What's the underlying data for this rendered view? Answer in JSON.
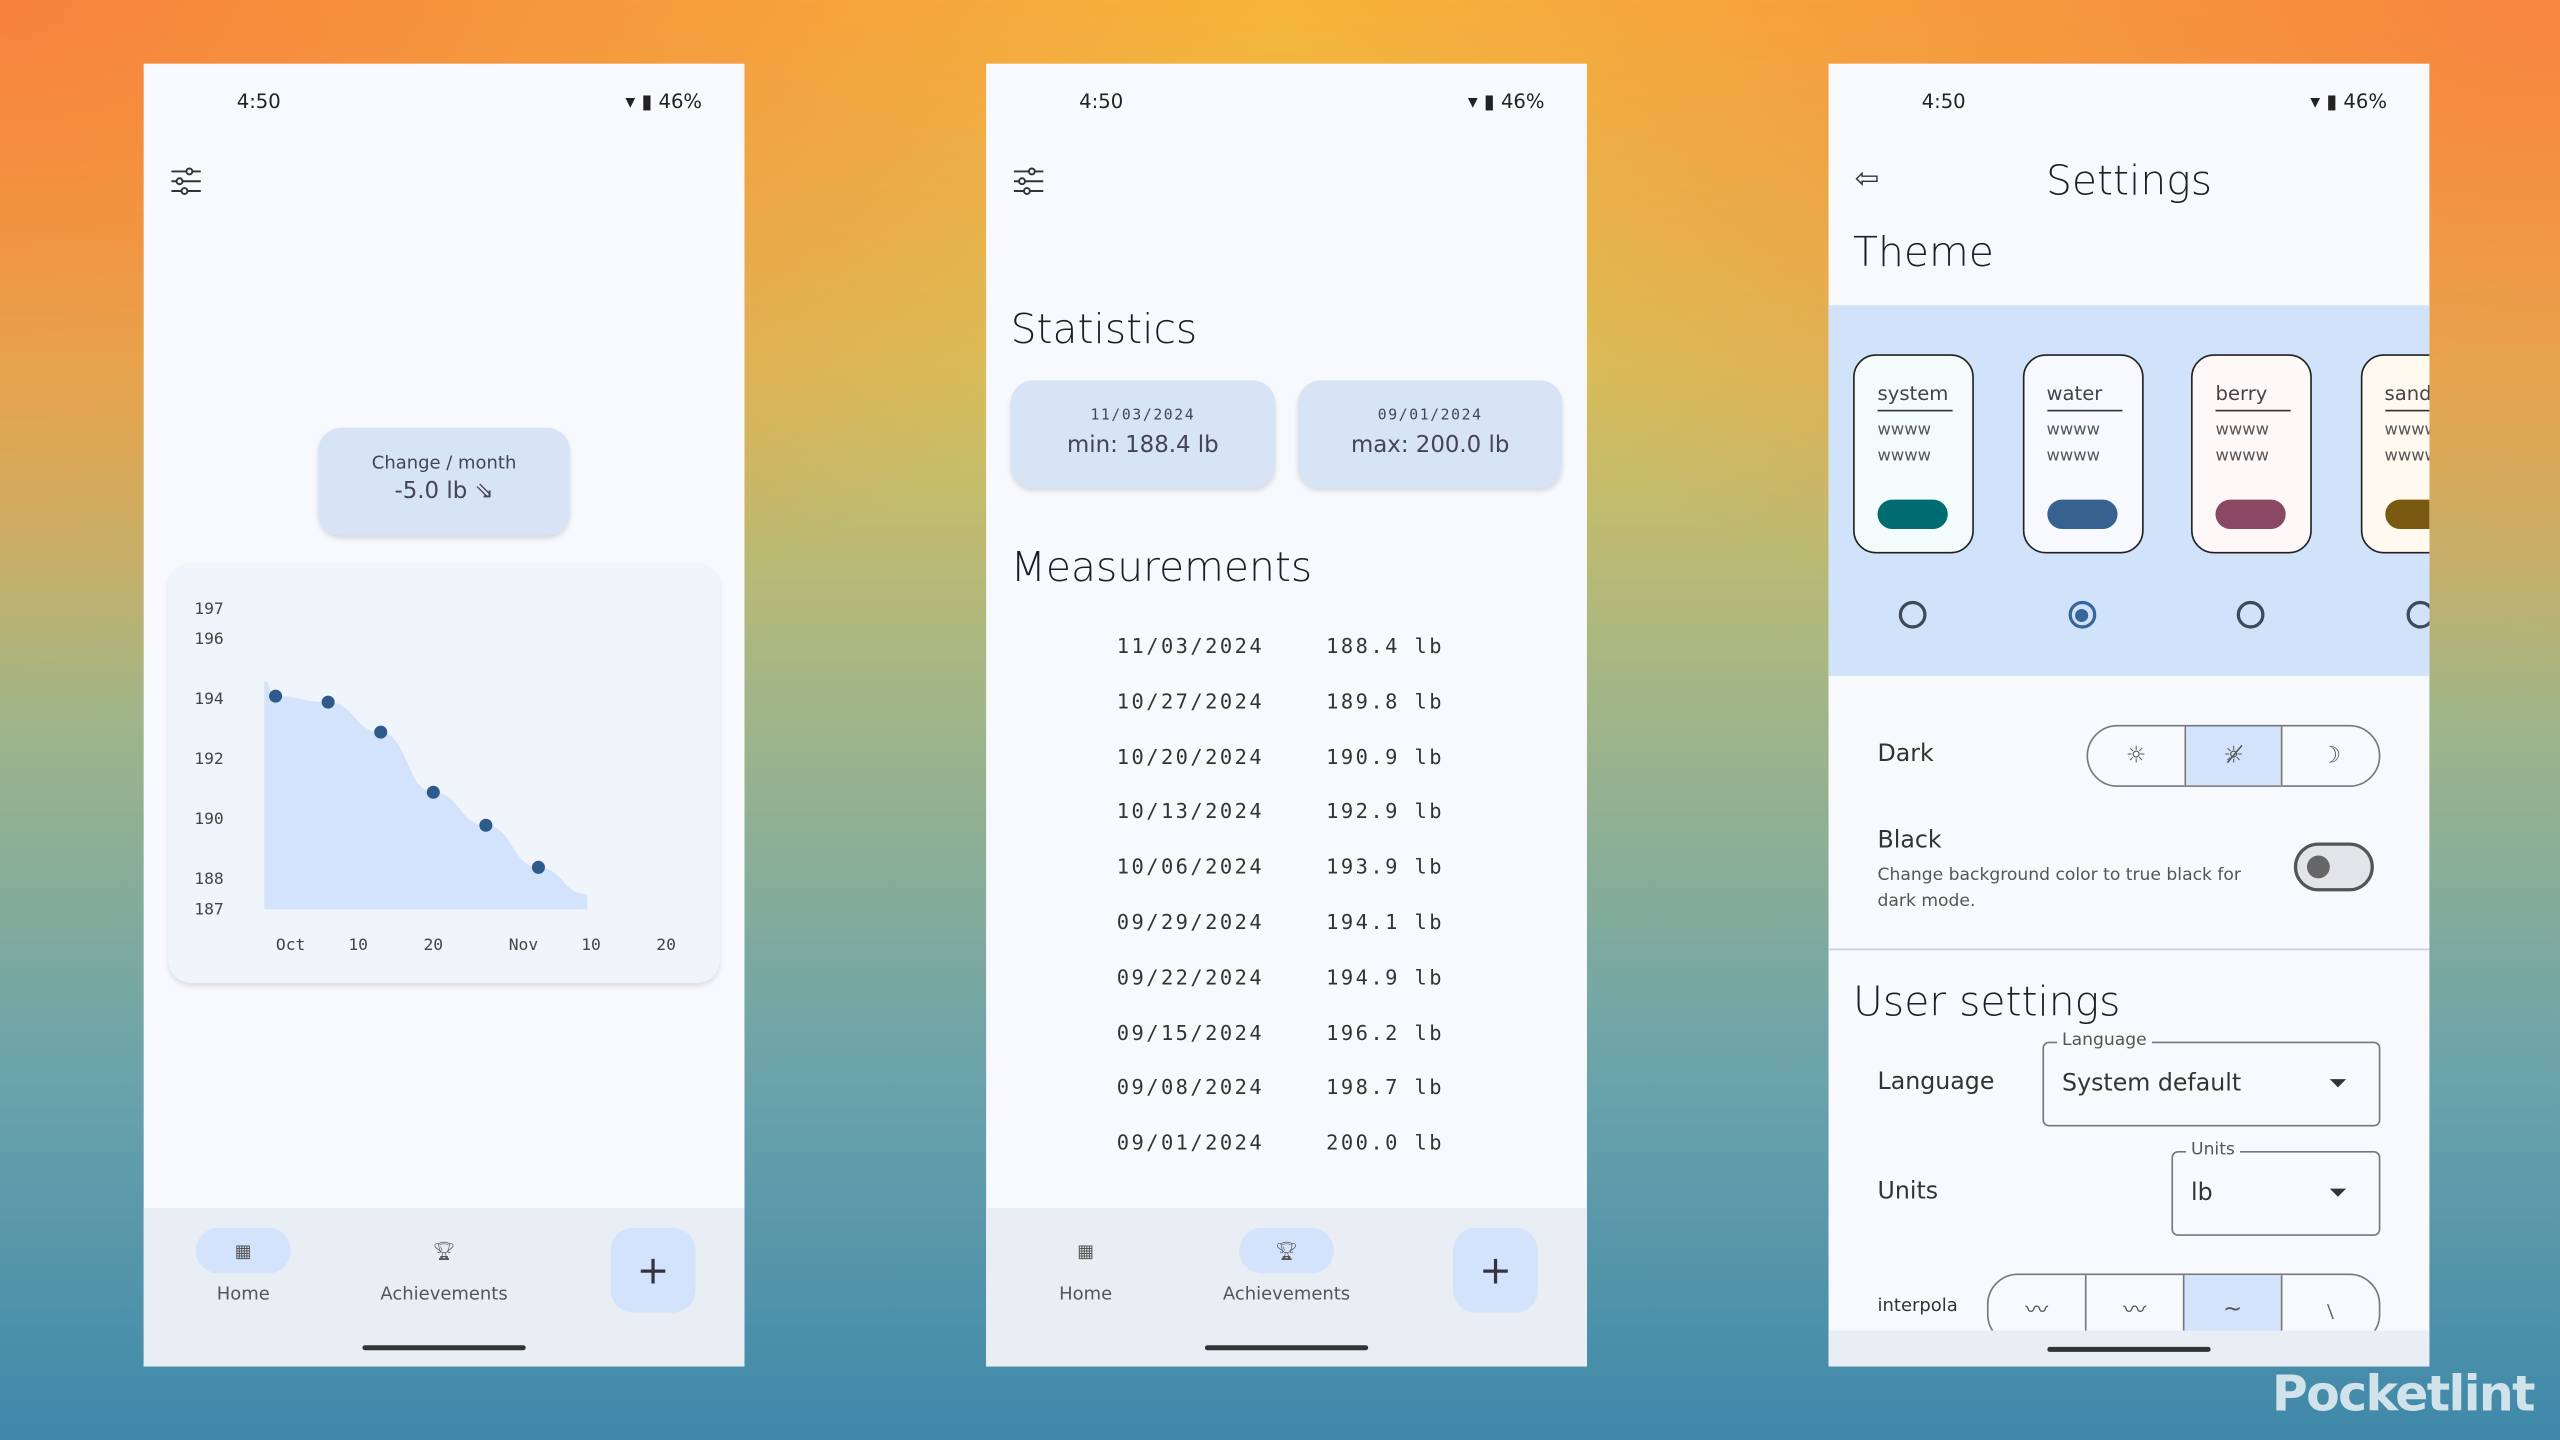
{
  "status": {
    "time": "4:50",
    "battery": "46%",
    "icons": [
      "wifi-icon",
      "battery-icon"
    ]
  },
  "home": {
    "change_card": {
      "label": "Change / month",
      "value": "-5.0 lb",
      "icon": "arrow-down-right-icon"
    },
    "nav": {
      "home": "Home",
      "achievements": "Achievements",
      "add": "+"
    }
  },
  "chart_data": {
    "type": "scatter",
    "x": [
      "2024-09-29",
      "2024-10-06",
      "2024-10-13",
      "2024-10-20",
      "2024-10-27",
      "2024-11-03"
    ],
    "values": [
      194.1,
      193.9,
      192.9,
      190.9,
      189.8,
      188.4
    ],
    "yticks": [
      "197",
      "196",
      "194",
      "192",
      "190",
      "188",
      "187"
    ],
    "xticks": [
      "Oct",
      "10",
      "20",
      "Nov",
      "10",
      "20"
    ],
    "ylim": [
      187,
      197
    ],
    "area_fill": "#d3e3fb",
    "point_color": "#2f5a8c"
  },
  "stats": {
    "title": "Statistics",
    "min": {
      "date": "11/03/2024",
      "value": "min: 188.4 lb"
    },
    "max": {
      "date": "09/01/2024",
      "value": "max: 200.0 lb"
    },
    "measurements_title": "Measurements",
    "measurements": [
      {
        "date": "11/03/2024",
        "weight": "188.4 lb"
      },
      {
        "date": "10/27/2024",
        "weight": "189.8 lb"
      },
      {
        "date": "10/20/2024",
        "weight": "190.9 lb"
      },
      {
        "date": "10/13/2024",
        "weight": "192.9 lb"
      },
      {
        "date": "10/06/2024",
        "weight": "193.9 lb"
      },
      {
        "date": "09/29/2024",
        "weight": "194.1 lb"
      },
      {
        "date": "09/22/2024",
        "weight": "194.9 lb"
      },
      {
        "date": "09/15/2024",
        "weight": "196.2 lb"
      },
      {
        "date": "09/08/2024",
        "weight": "198.7 lb"
      },
      {
        "date": "09/01/2024",
        "weight": "200.0 lb"
      }
    ]
  },
  "settings": {
    "title": "Settings",
    "theme_title": "Theme",
    "themes": [
      {
        "name": "system",
        "sample": "wwww",
        "color": "#006b70",
        "bg": "#f4fbfb",
        "selected": false
      },
      {
        "name": "water",
        "sample": "wwww",
        "color": "#37618f",
        "bg": "#f7f9fe",
        "selected": true
      },
      {
        "name": "berry",
        "sample": "wwww",
        "color": "#8b4863",
        "bg": "#fff8f8",
        "selected": false
      },
      {
        "name": "sand",
        "sample": "wwww",
        "color": "#7a5a10",
        "bg": "#fff9ef",
        "selected": false
      }
    ],
    "dark_label": "Dark",
    "dark_options": [
      "light",
      "auto",
      "dark"
    ],
    "dark_selected": "auto",
    "black_label": "Black",
    "black_desc": "Change background color to true black for dark mode.",
    "black_enabled": false,
    "user_settings_title": "User settings",
    "language_label": "Language",
    "language_legend": "Language",
    "language_value": "System default",
    "units_label": "Units",
    "units_legend": "Units",
    "units_value": "lb",
    "interpolation_label": "interpola",
    "interpolation_selected": 3
  },
  "watermark": "Pocketlint"
}
